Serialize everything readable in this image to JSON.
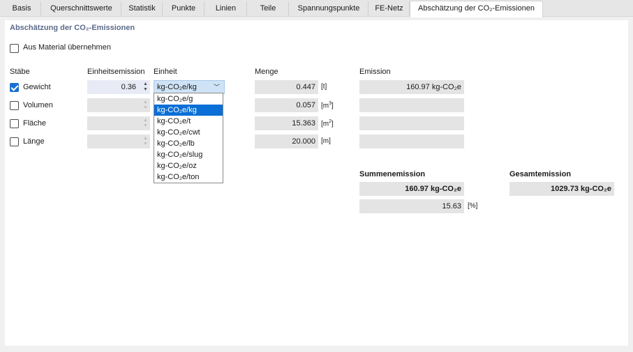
{
  "tabs": [
    {
      "label": "Basis"
    },
    {
      "label": "Querschnittswerte"
    },
    {
      "label": "Statistik"
    },
    {
      "label": "Punkte"
    },
    {
      "label": "Linien"
    },
    {
      "label": "Teile"
    },
    {
      "label": "Spannungspunkte"
    },
    {
      "label": "FE-Netz"
    },
    {
      "label": "Abschätzung der CO₂-Emissionen"
    }
  ],
  "active_tab": "Abschätzung der CO₂-Emissionen",
  "section_title": "Abschätzung der CO₂-Emissionen",
  "from_material": {
    "label": "Aus Material übernehmen",
    "checked": false
  },
  "headers": {
    "staebe": "Stäbe",
    "einheitsemission": "Einheitsemission",
    "einheit": "Einheit",
    "menge": "Menge",
    "emission": "Emission"
  },
  "rows": [
    {
      "label": "Gewicht",
      "checked": true,
      "unit_emission": "0.36",
      "quantity": "0.447",
      "quantity_unit": "[t]",
      "emission": "160.97 kg-CO₂e"
    },
    {
      "label": "Volumen",
      "checked": false,
      "unit_emission": "",
      "quantity": "0.057",
      "quantity_unit": "[m",
      "quantity_unit_sup": "3",
      "quantity_unit_end": "]",
      "emission": ""
    },
    {
      "label": "Fläche",
      "checked": false,
      "unit_emission": "",
      "quantity": "15.363",
      "quantity_unit": "[m",
      "quantity_unit_sup": "2",
      "quantity_unit_end": "]",
      "emission": ""
    },
    {
      "label": "Länge",
      "checked": false,
      "unit_emission": "",
      "quantity": "20.000",
      "quantity_unit": "[m]",
      "emission": ""
    }
  ],
  "unit_combo": {
    "value": "kg-CO₂e/kg",
    "arrow": "﹀"
  },
  "unit_options": [
    "kg-CO₂e/g",
    "kg-CO₂e/kg",
    "kg-CO₂e/t",
    "kg-CO₂e/cwt",
    "kg-CO₂e/lb",
    "kg-CO₂e/slug",
    "kg-CO₂e/oz",
    "kg-CO₂e/ton"
  ],
  "unit_selected_index": 1,
  "summenemission": {
    "label": "Summenemission",
    "value": "160.97 kg-CO₂e",
    "percent": "15.63",
    "percent_unit": "[%]"
  },
  "gesamtemission": {
    "label": "Gesamtemission",
    "value": "1029.73 kg-CO₂e"
  },
  "spinner": {
    "up": "▲",
    "down": "▼"
  },
  "colors": {
    "accent": "#1a6fd1",
    "selection": "#0a6fd6",
    "title": "#5b6b8a",
    "field": "#e4e4e4"
  }
}
